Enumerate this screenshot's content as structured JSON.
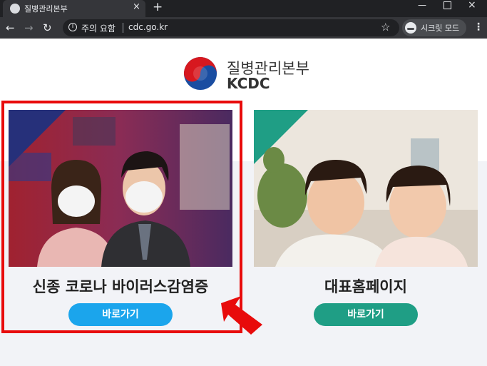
{
  "browser": {
    "tab_title": "질병관리본부",
    "tab_close": "×",
    "new_tab": "+",
    "window_min": "—",
    "window_close": "×",
    "back": "←",
    "forward": "→",
    "reload": "↻",
    "security_warning": "주의 요함",
    "url": "cdc.go.kr",
    "star": "☆",
    "incognito_label": "시크릿 모드",
    "menu": "⋮"
  },
  "header": {
    "org_name_ko": "질병관리본부",
    "org_name_en": "KCDC"
  },
  "cards": [
    {
      "title": "신종 코로나 바이러스감염증",
      "button_label": "바로가기",
      "button_color": "#1ba5ec"
    },
    {
      "title": "대표홈페이지",
      "button_label": "바로가기",
      "button_color": "#1f9e85"
    }
  ],
  "colors": {
    "highlight_box": "#e80b0b",
    "arrow": "#e80b0b",
    "card1_corner": "#26307a",
    "card2_corner": "#1f9e85"
  }
}
